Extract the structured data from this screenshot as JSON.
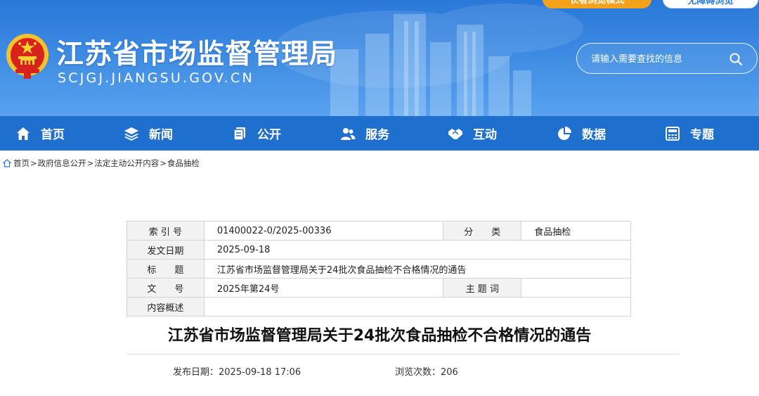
{
  "header": {
    "elder_mode_label": "长者浏览模式",
    "barrier_free_label": "无障碍浏览",
    "site_title": "江苏省市场监督管理局",
    "site_domain": "SCJGJ.JIANGSU.GOV.CN",
    "search": {
      "placeholder": "请输入需要查找的信息"
    }
  },
  "nav": {
    "items": [
      {
        "label": "首页",
        "icon": "home-icon"
      },
      {
        "label": "新闻",
        "icon": "layers-icon"
      },
      {
        "label": "公开",
        "icon": "document-stack-icon"
      },
      {
        "label": "服务",
        "icon": "users-icon"
      },
      {
        "label": "互动",
        "icon": "handshake-icon"
      },
      {
        "label": "数据",
        "icon": "pie-chart-icon"
      },
      {
        "label": "专题",
        "icon": "calculator-icon"
      }
    ]
  },
  "breadcrumb": {
    "icon": "home-outline-icon",
    "items": [
      "首页",
      "政府信息公开",
      "法定主动公开内容",
      "食品抽检"
    ],
    "separator": ">"
  },
  "info_table": {
    "index_label": "索 引 号",
    "index_value": "01400022-0/2025-00336",
    "category_label": "分　　类",
    "category_value": "食品抽检",
    "date_label": "发文日期",
    "date_value": "2025-09-18",
    "title_label": "标　　题",
    "title_value": "江苏省市场监督管理局关于24批次食品抽检不合格情况的通告",
    "docno_label": "文　　号",
    "docno_value": "2025年第24号",
    "keywords_label": "主 题 词",
    "keywords_value": "",
    "summary_label": "内容概述",
    "summary_value": ""
  },
  "article": {
    "title": "江苏省市场监督管理局关于24批次食品抽检不合格情况的通告",
    "publish_label": "发布日期：",
    "publish_value": "2025-09-18 17:06",
    "views_label": "浏览次数：",
    "views_value": "206"
  },
  "colors": {
    "banner_blue": "#2a78d8",
    "nav_blue": "#1f6fcf",
    "elder_orange": "#f4a21c"
  }
}
